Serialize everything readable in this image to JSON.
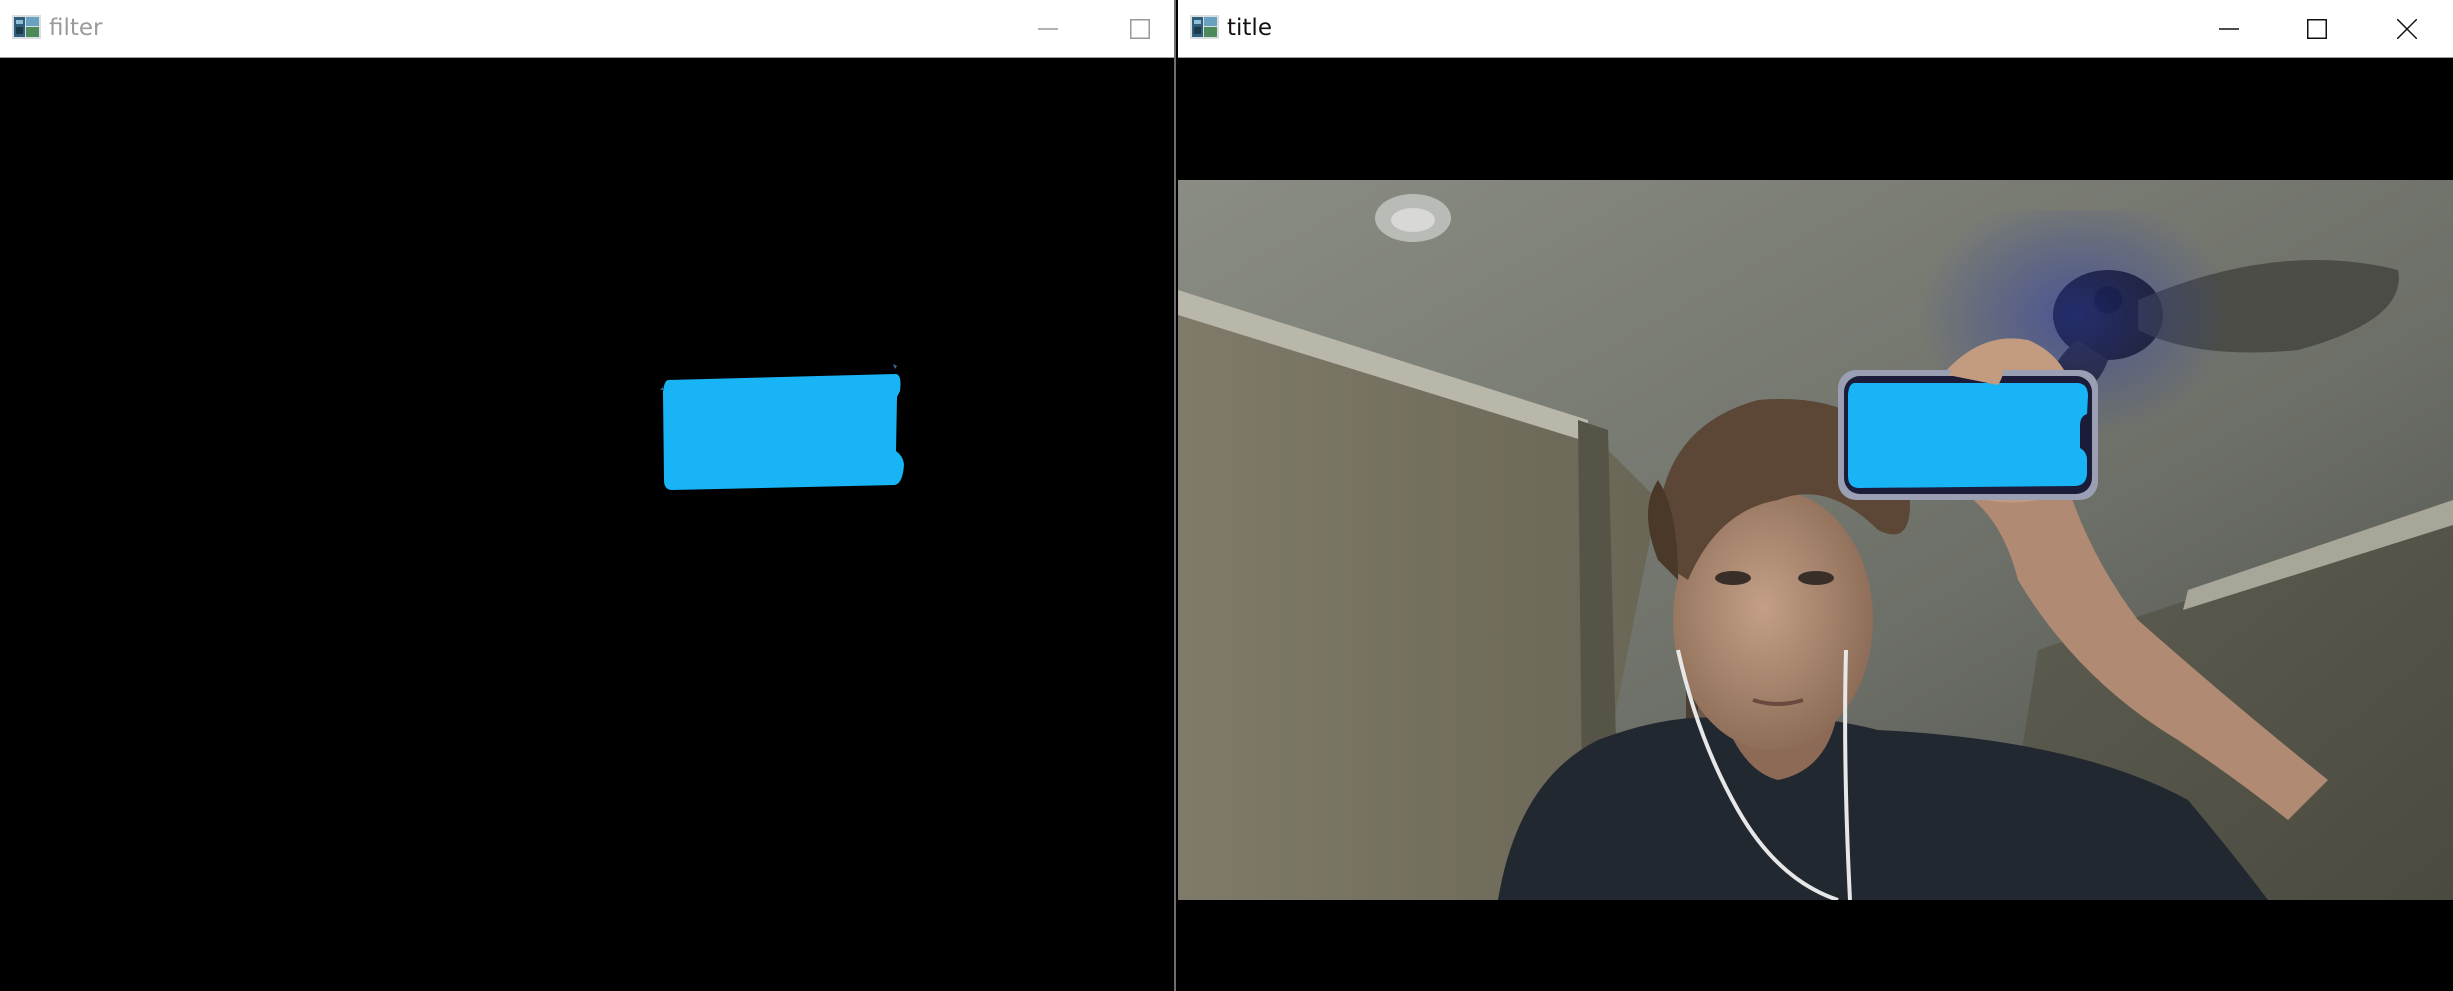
{
  "filter_window": {
    "title": "filter",
    "title_color": "#9a9a9a",
    "controls": [
      "minimize-icon",
      "maximize-icon"
    ]
  },
  "title_window": {
    "title": "title",
    "title_color": "#111111",
    "controls": [
      "minimize-icon",
      "maximize-icon",
      "close-icon"
    ]
  },
  "colors": {
    "detected_blue": "#18b4f6",
    "background": "#000000",
    "titlebar": "#ffffff"
  }
}
